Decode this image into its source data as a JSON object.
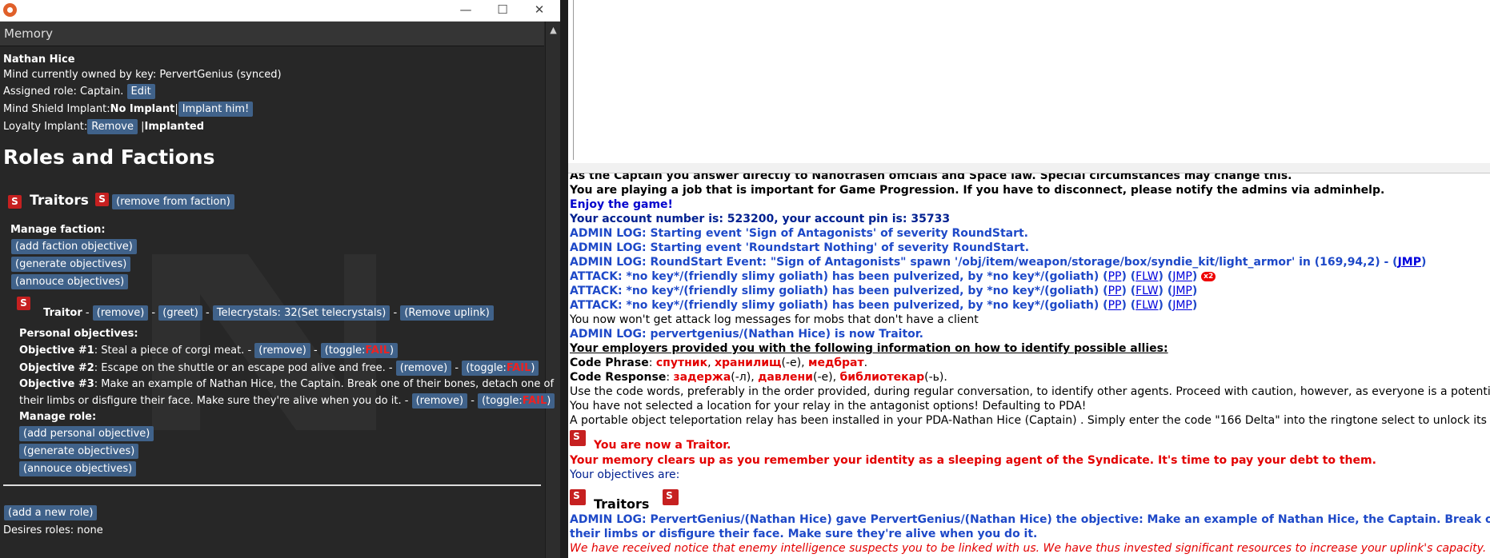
{
  "window": {
    "title": "",
    "min": "—",
    "max": "☐",
    "close": "✕"
  },
  "panel": {
    "title": "Memory"
  },
  "mind": {
    "name": "Nathan Hice",
    "owner": "Mind currently owned by key: PervertGenius (synced)",
    "role_prefix": "Assigned role: Captain.",
    "edit": "Edit",
    "shield_prefix": "Mind Shield Implant:",
    "shield_status": "No Implant",
    "shield_sep": "|",
    "shield_btn": "Implant him!",
    "loyalty_prefix": "Loyalty Implant:",
    "loyalty_btn": "Remove",
    "loyalty_sep": "|",
    "loyalty_status": "Implanted"
  },
  "roles_heading": "Roles and Factions",
  "faction": {
    "name": "Traitors",
    "remove": "(remove from faction)",
    "manage_label": "Manage faction:",
    "buttons": [
      "(add faction objective)",
      "(generate objectives)",
      "(annouce objectives)"
    ]
  },
  "traitor": {
    "label": "Traitor",
    "dash": "-",
    "remove": "(remove)",
    "greet": "(greet)",
    "telecrystals": "Telecrystals: 32(Set telecrystals)",
    "remove_uplink": "(Remove uplink)"
  },
  "objectives": {
    "label": "Personal objectives:",
    "items": [
      {
        "num": "Objective #1",
        "text": ": Steal a piece of corgi meat. -",
        "line2": ""
      },
      {
        "num": "Objective #2",
        "text": ": Escape on the shuttle or an escape pod alive and free. -",
        "line2": ""
      },
      {
        "num": "Objective #3",
        "text": ": Make an example of Nathan Hice, the Captain. Break one of their bones, detach one of",
        "line2": "their limbs or disfigure their face. Make sure they're alive when you do it. -"
      }
    ],
    "remove": "(remove)",
    "toggle_prefix": "(toggle:",
    "fail": "FAIL",
    "toggle_suffix": ")"
  },
  "manage_role": {
    "label": "Manage role:",
    "buttons": [
      "(add personal objective)",
      "(generate objectives)",
      "(annouce objectives)"
    ]
  },
  "add_role": "(add a new role)",
  "desires": "Desires roles: none",
  "chat": {
    "l0": "As the Captain you answer directly to Nanotrasen officials and Space law. Special circumstances may change this.",
    "l1": "You are playing a job that is important for Game Progression. If you have to disconnect, please notify the admins via adminhelp.",
    "l2": "Enjoy the game!",
    "l3": "Your account number is: 523200, your account pin is: 35733",
    "l4": "ADMIN LOG: Starting event 'Sign of Antagonists' of severity RoundStart.",
    "l5": "ADMIN LOG: Starting event 'Roundstart Nothing' of severity RoundStart.",
    "l6": "ADMIN LOG: RoundStart Event: \"Sign of Antagonists\" spawn '/obj/item/weapon/storage/box/syndie_kit/light_armor' in (169,94,2) - (",
    "jmp": "JMP",
    "close_paren": ")",
    "attack": "ATTACK: *no key*/(friendly slimy goliath) has been pulverized, by *no key*/(goliath)",
    "pp": "PP",
    "flw": "FLW",
    "badge": "x2",
    "l10": "You now won't get attack log messages for mobs that don't have a client",
    "l11": "ADMIN LOG: pervertgenius/(Nathan Hice) is now Traitor.",
    "l12": "Your employers provided you with the following information on how to identify possible allies:",
    "phrase_label": "Code Phrase",
    "phrase_w1": "спутник",
    "phrase_w2": "хранилищ",
    "phrase_s2": "(-е),",
    "phrase_w3": "медбрат",
    "response_label": "Code Response",
    "resp_w1": "задержа",
    "resp_s1": "(-л),",
    "resp_w2": "давлени",
    "resp_s2": "(-е),",
    "resp_w3": "библиотекар",
    "resp_s3": "(-ь).",
    "l15": "Use the code words, preferably in the order provided, during regular conversation, to identify other agents. Proceed with caution, however, as everyone is a potential foe.",
    "l16": "You have not selected a location for your relay in the antagonist options! Defaulting to PDA!",
    "l17": "A portable object teleportation relay has been installed in your PDA-Nathan Hice (Captain) . Simply enter the code \"166 Delta\" into the ringtone select to unlock its hidden features.",
    "l18": "You are now a Traitor.",
    "l19": "Your memory clears up as you remember your identity as a sleeping agent of the Syndicate. It's time to pay your debt to them.",
    "l20": "Your objectives are:",
    "l21": "Traitors",
    "l22a": "ADMIN LOG: PervertGenius/(Nathan Hice) gave PervertGenius/(Nathan Hice) the objective: Make an example of Nathan Hice, the Captain. Break one of their bones, detach one of",
    "l22b": "their limbs or disfigure their face. Make sure they're alive when you do it.",
    "l23": "We have received notice that enemy intelligence suspects you to be linked with us. We have thus invested significant resources to increase your uplink's capacity."
  }
}
